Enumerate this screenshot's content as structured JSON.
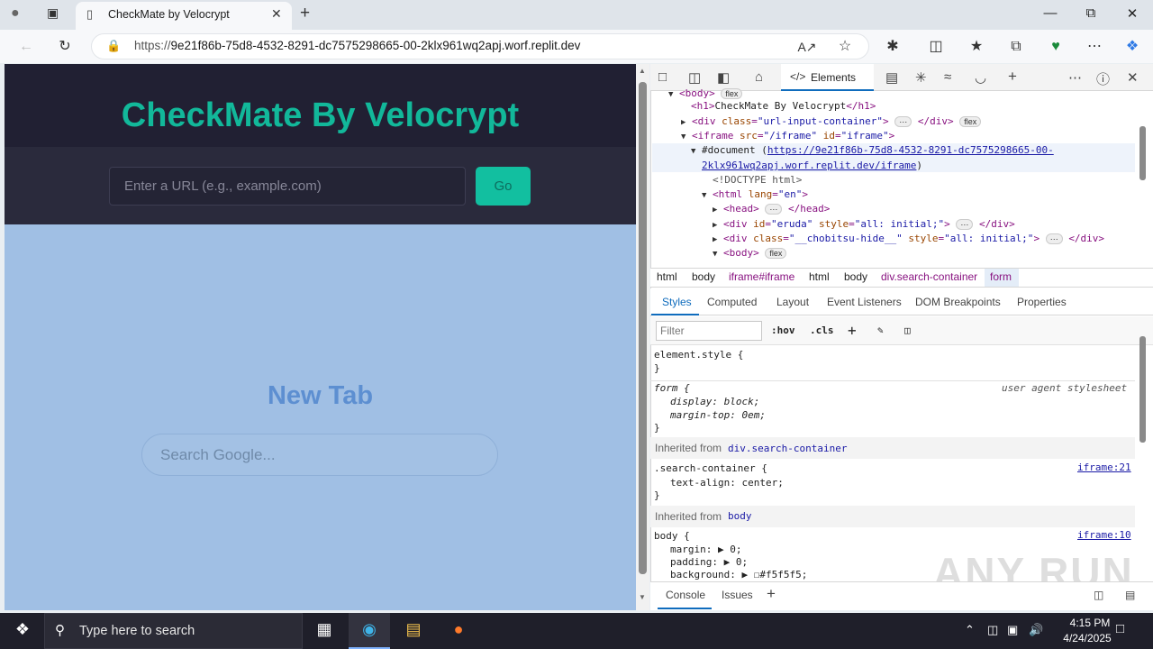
{
  "browser": {
    "tab_title": "CheckMate by Velocrypt",
    "url_prefix": "https://",
    "url_domain": "9e21f86b-75d8-4532-8291-dc7575298665-00-2klx961wq2apj.worf.replit.dev"
  },
  "page": {
    "header_title": "CheckMate By Velocrypt",
    "url_placeholder": "Enter a URL (e.g., example.com)",
    "go_label": "Go",
    "newtab_title": "New Tab",
    "search_placeholder": "Search Google..."
  },
  "devtools": {
    "elements_tab": "Elements",
    "dom": {
      "l1_tag": "<body>",
      "l1_pill": "flex",
      "l2": "CheckMate By Velocrypt",
      "l3_class": "\"url-input-container\"",
      "l3_pill": "flex",
      "l4_src": "\"/iframe\"",
      "l4_id": "\"iframe\"",
      "l5_doc": "#document",
      "l5_link1": "https://9e21f86b-75d8-4532-8291-dc7575298665-00-",
      "l5_link2": "2klx961wq2apj.worf.replit.dev/iframe",
      "l6": "<!DOCTYPE html>",
      "l7_lang": "\"en\"",
      "l9_id": "\"eruda\"",
      "l9_style": "\"all: initial;\"",
      "l10_class": "\"__chobitsu-hide__\"",
      "l10_style": "\"all: initial;\"",
      "l11_pill": "flex"
    },
    "crumbs": [
      "html",
      "body",
      "iframe#iframe",
      "html",
      "body",
      "div.search-container",
      "form"
    ],
    "subtabs": [
      "Styles",
      "Computed",
      "Layout",
      "Event Listeners",
      "DOM Breakpoints",
      "Properties"
    ],
    "filter_placeholder": "Filter",
    "tools": {
      "hov": ":hov",
      "cls": ".cls"
    },
    "styles": {
      "element_style": "element.style {",
      "close": "}",
      "form_sel": "form {",
      "ua": "user agent stylesheet",
      "form_p1": "display: block;",
      "form_p2": "margin-top: 0em;",
      "inh1_label": "Inherited from",
      "inh1_sel": "div.search-container",
      "sc_sel": ".search-container {",
      "sc_src": "iframe:21",
      "sc_p1": "text-align: center;",
      "inh2_label": "Inherited from",
      "inh2_sel": "body",
      "body_sel": "body {",
      "body_src": "iframe:10",
      "body_p1": "margin: ▶ 0;",
      "body_p2": "padding: ▶ 0;",
      "body_p3": "background: ▶ ☐#f5f5f5;"
    },
    "console_tab": "Console",
    "issues_tab": "Issues"
  },
  "watermark": "ANY RUN",
  "taskbar": {
    "search_text": "Type here to search",
    "time": "4:15 PM",
    "date": "4/24/2025"
  }
}
